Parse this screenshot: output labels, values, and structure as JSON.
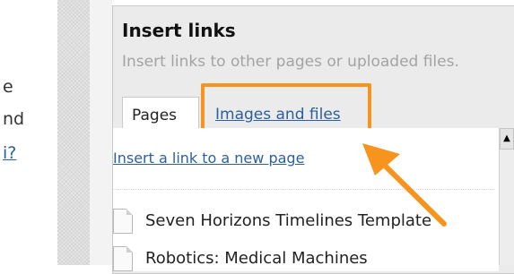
{
  "left_column": {
    "line1": "e",
    "line2": "nd",
    "line3": "i?"
  },
  "panel": {
    "title": "Insert links",
    "subtitle": "Insert links to other pages or uploaded files."
  },
  "tabs": [
    {
      "label": "Pages",
      "active": true
    },
    {
      "label": "Images and files",
      "active": false
    }
  ],
  "content": {
    "new_page_link": "Insert a link to a new page",
    "items": [
      "Seven Horizons Timelines Template",
      "Robotics: Medical Machines"
    ]
  },
  "colors": {
    "highlight": "#f7941d",
    "link": "#2b5f9e"
  },
  "icons": {
    "page": "document-icon",
    "scroll_up": "triangle-up-icon",
    "callout": "orange-arrow-icon"
  }
}
